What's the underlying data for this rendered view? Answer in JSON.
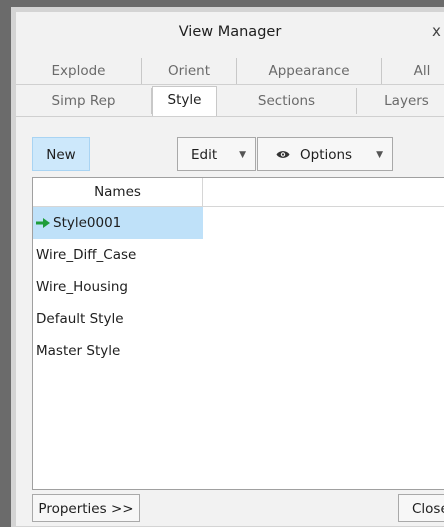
{
  "window": {
    "title": "View Manager",
    "close_glyph": "x"
  },
  "tabs": {
    "row1": [
      {
        "label": "Explode"
      },
      {
        "label": "Orient"
      },
      {
        "label": "Appearance"
      },
      {
        "label": "All"
      }
    ],
    "row2": [
      {
        "label": "Simp Rep"
      },
      {
        "label": "Style",
        "active": true
      },
      {
        "label": "Sections"
      },
      {
        "label": "Layers"
      }
    ]
  },
  "toolbar": {
    "new_label": "New",
    "edit_label": "Edit",
    "options_label": "Options",
    "dropdown_glyph": "▼"
  },
  "list": {
    "column_header": "Names",
    "items": [
      {
        "name": "Style0001",
        "selected": true,
        "icon": "green-arrow-icon"
      },
      {
        "name": "Wire_Diff_Case"
      },
      {
        "name": "Wire_Housing"
      },
      {
        "name": "Default Style"
      },
      {
        "name": "Master Style"
      }
    ]
  },
  "footer": {
    "properties_label": "Properties >>",
    "close_label": "Close"
  },
  "colors": {
    "selection": "#bfe1f9",
    "new_button_bg": "#cde8fb",
    "arrow_green": "#1f9d3a"
  }
}
